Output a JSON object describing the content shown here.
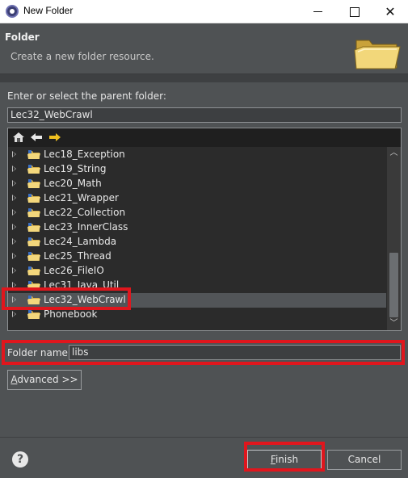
{
  "window": {
    "title": "New Folder"
  },
  "header": {
    "title": "Folder",
    "description": "Create a new folder resource."
  },
  "parent_folder": {
    "label": "Enter or select the parent folder:",
    "value": "Lec32_WebCrawl"
  },
  "tree": {
    "items": [
      {
        "label": "Lec18_Exception",
        "selected": false
      },
      {
        "label": "Lec19_String",
        "selected": false
      },
      {
        "label": "Lec20_Math",
        "selected": false
      },
      {
        "label": "Lec21_Wrapper",
        "selected": false
      },
      {
        "label": "Lec22_Collection",
        "selected": false
      },
      {
        "label": "Lec23_InnerClass",
        "selected": false
      },
      {
        "label": "Lec24_Lambda",
        "selected": false
      },
      {
        "label": "Lec25_Thread",
        "selected": false
      },
      {
        "label": "Lec26_FileIO",
        "selected": false
      },
      {
        "label": "Lec31_Java_Util",
        "selected": false
      },
      {
        "label": "Lec32_WebCrawl",
        "selected": true
      },
      {
        "label": "Phonebook",
        "selected": false
      }
    ]
  },
  "folder_name": {
    "label": "Folder name:",
    "value": "libs"
  },
  "buttons": {
    "advanced_prefix": "A",
    "advanced_rest": "dvanced >>",
    "finish_prefix": "F",
    "finish_rest": "inish",
    "cancel": "Cancel",
    "help": "?"
  },
  "colors": {
    "highlight": "#e0161d",
    "dialog_bg": "#4f5254",
    "tree_bg": "#2b2b2b"
  }
}
